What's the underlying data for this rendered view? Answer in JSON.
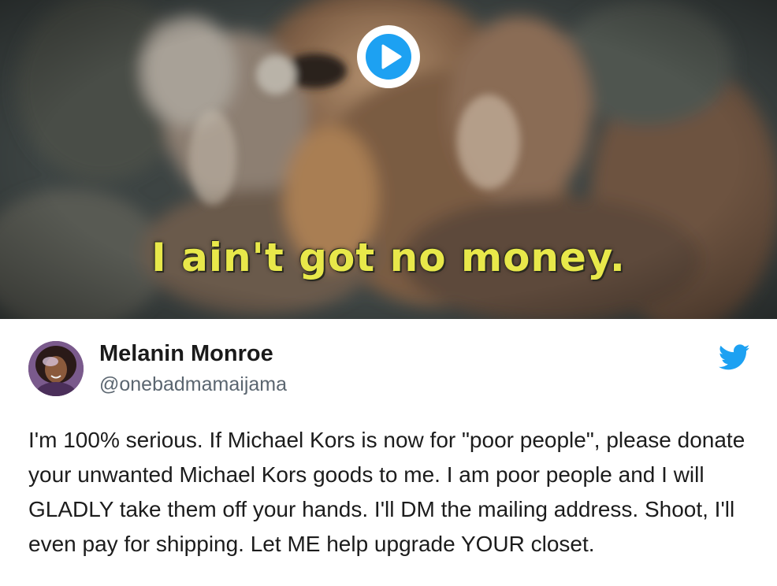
{
  "media": {
    "caption": "I ain't got no money.",
    "play_icon": "play-icon"
  },
  "tweet": {
    "display_name": "Melanin Monroe",
    "handle": "@onebadmamaijama",
    "brand_icon": "twitter-bird-icon",
    "text": "I'm 100% serious. If Michael Kors is now for \"poor people\", please donate your unwanted Michael Kors goods to me. I am poor people and I will GLADLY take them off your hands. I'll DM the mailing address. Shoot, I'll even pay for shipping. Let ME help upgrade YOUR closet."
  },
  "colors": {
    "twitter_blue": "#1da1f2",
    "caption_yellow": "#e8e84a",
    "text_primary": "#1c1c1c",
    "text_secondary": "#5b6670"
  }
}
